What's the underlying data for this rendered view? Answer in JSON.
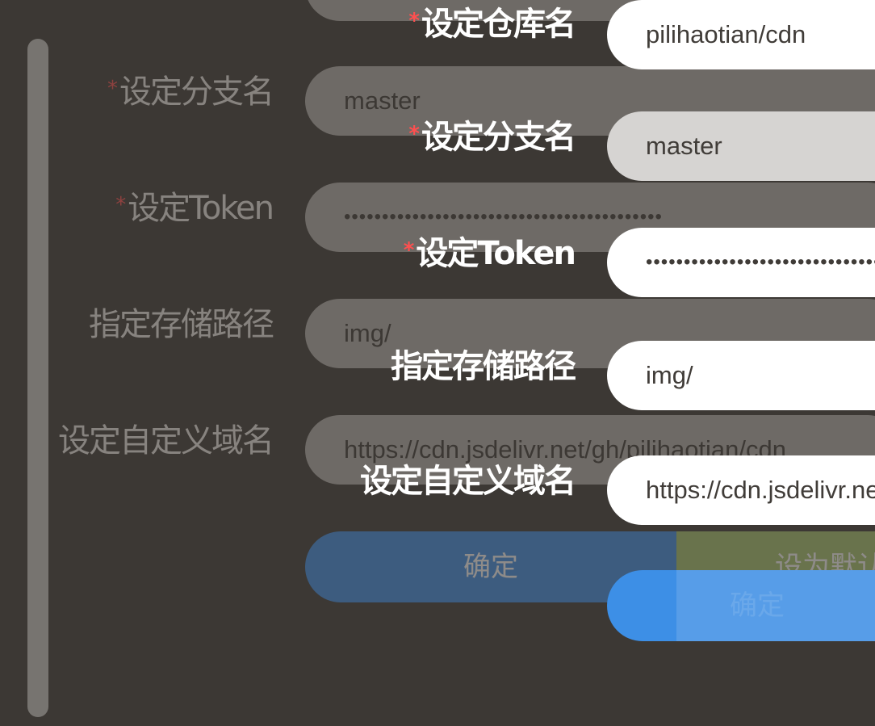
{
  "form": {
    "repo": {
      "label": "设定仓库名",
      "value": "pilihaotian/cdn",
      "required": true
    },
    "branch": {
      "label": "设定分支名",
      "value": "master",
      "required": true
    },
    "token": {
      "label": "设定Token",
      "value": "••••••••••••••••••••••••••••••••••••••••••",
      "required": true
    },
    "path": {
      "label": "指定存储路径",
      "value": "img/",
      "required": false
    },
    "domain": {
      "label": "设定自定义域名",
      "value": "https://cdn.jsdelivr.net/gh/pilihaotian/cdn",
      "required": false
    },
    "required_mark": "*",
    "confirm_label": "确定",
    "default_label": "设为默认"
  },
  "front_form": {
    "repo_value": "pilihaotian/cdn",
    "branch_value": "master",
    "token_value": "••••••••••••••••••••••••••••••••••••••••",
    "path_value": "img/",
    "domain_value": "https://cdn.jsdelivr.net/gh/pilihaotian/cdn",
    "confirm_label": "确定"
  },
  "colors": {
    "background": "#3c3834",
    "primary": "#3d8fe6",
    "success": "#a8c66e",
    "required": "#ff4f4f"
  }
}
